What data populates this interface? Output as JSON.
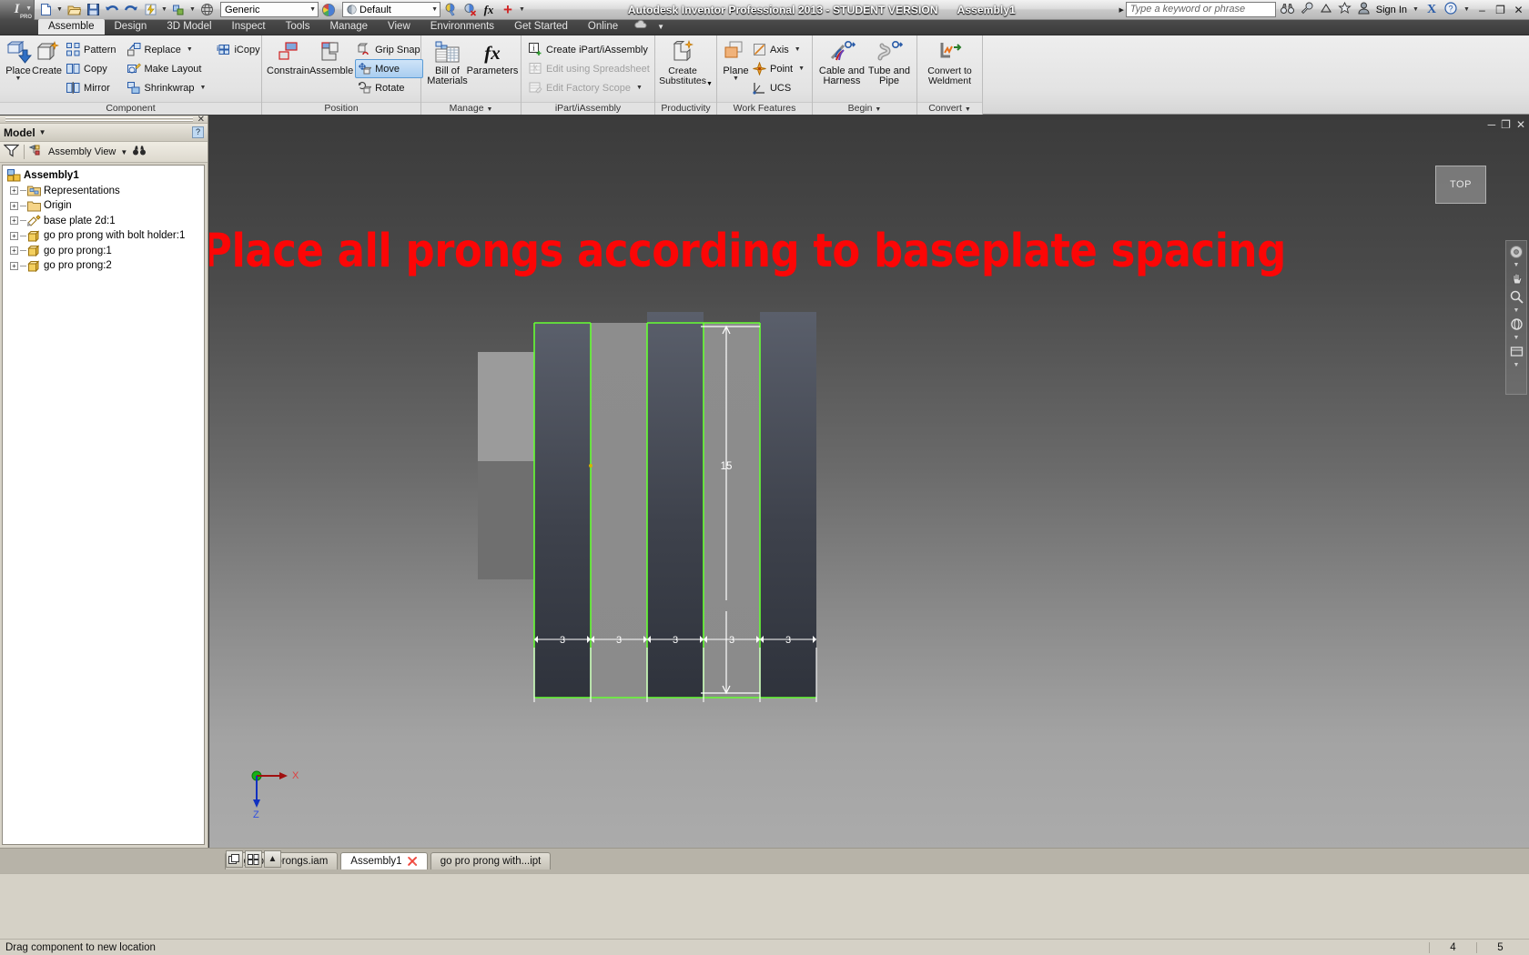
{
  "titlebar": {
    "app_title": "Autodesk Inventor Professional 2013 - STUDENT VERSION",
    "document_name": "Assembly1",
    "material_combo": "Generic",
    "appearance_combo": "Default",
    "search_placeholder": "Type a keyword or phrase",
    "sign_in": "Sign In",
    "minimize": "–",
    "restore": "❐",
    "close": "✕"
  },
  "ribbon_tabs": [
    {
      "label": "Assemble",
      "active": true
    },
    {
      "label": "Design",
      "active": false
    },
    {
      "label": "3D Model",
      "active": false
    },
    {
      "label": "Inspect",
      "active": false
    },
    {
      "label": "Tools",
      "active": false
    },
    {
      "label": "Manage",
      "active": false
    },
    {
      "label": "View",
      "active": false
    },
    {
      "label": "Environments",
      "active": false
    },
    {
      "label": "Get Started",
      "active": false
    },
    {
      "label": "Online",
      "active": false
    }
  ],
  "ribbon_panels": {
    "component": {
      "label": "Component",
      "place": "Place",
      "create": "Create",
      "pattern": "Pattern",
      "copy": "Copy",
      "mirror": "Mirror",
      "replace": "Replace",
      "make_layout": "Make Layout",
      "shrinkwrap": "Shrinkwrap",
      "icopy": "iCopy"
    },
    "position": {
      "label": "Position",
      "constrain": "Constrain",
      "assemble": "Assemble",
      "grip_snap": "Grip Snap",
      "move": "Move",
      "rotate": "Rotate"
    },
    "manage": {
      "label": "Manage",
      "bill_of_materials": "Bill of\nMaterials",
      "bom_line1": "Bill of",
      "bom_line2": "Materials",
      "parameters": "Parameters"
    },
    "ipart": {
      "label": "iPart/iAssembly",
      "create_ipart": "Create iPart/iAssembly",
      "edit_spreadsheet": "Edit using Spreadsheet",
      "edit_factory_scope": "Edit Factory Scope"
    },
    "productivity": {
      "label": "Productivity",
      "create_line1": "Create",
      "create_line2": "Substitutes"
    },
    "work_features": {
      "label": "Work Features",
      "plane": "Plane",
      "axis": "Axis",
      "point": "Point",
      "ucs": "UCS"
    },
    "begin": {
      "label": "Begin",
      "cable_line1": "Cable and",
      "cable_line2": "Harness",
      "tube_line1": "Tube and",
      "tube_line2": "Pipe"
    },
    "convert": {
      "label": "Convert",
      "convert_line1": "Convert to",
      "convert_line2": "Weldment"
    }
  },
  "browser": {
    "panel_title": "Model",
    "view_selector": "Assembly View",
    "help_badge": "?",
    "tree": [
      {
        "label": "Assembly1",
        "depth": 0,
        "expandable": false,
        "icon": "assembly-icon"
      },
      {
        "label": "Representations",
        "depth": 1,
        "expandable": true,
        "icon": "representations-folder-icon"
      },
      {
        "label": "Origin",
        "depth": 1,
        "expandable": true,
        "icon": "folder-icon"
      },
      {
        "label": "base plate 2d:1",
        "depth": 1,
        "expandable": true,
        "icon": "sketch-part-icon"
      },
      {
        "label": "go pro prong with bolt holder:1",
        "depth": 1,
        "expandable": true,
        "icon": "part-icon"
      },
      {
        "label": "go pro prong:1",
        "depth": 1,
        "expandable": true,
        "icon": "part-icon"
      },
      {
        "label": "go pro prong:2",
        "depth": 1,
        "expandable": true,
        "icon": "part-icon"
      }
    ]
  },
  "viewport": {
    "annotation": "Place all prongs according to baseplate spacing",
    "annotation_color": "#fc0606",
    "viewcube_label": "TOP",
    "vertical_dimension": "15",
    "horizontal_dimensions": [
      "3",
      "3",
      "3",
      "3",
      "3"
    ],
    "axis_x": "X",
    "axis_z": "Z",
    "highlight_color": "#66ff33"
  },
  "document_tabs": [
    {
      "label": "3 go pro prongs.iam",
      "active": false,
      "closable": false
    },
    {
      "label": "Assembly1",
      "active": true,
      "closable": true
    },
    {
      "label": "go pro prong with...ipt",
      "active": false,
      "closable": false
    }
  ],
  "statusbar": {
    "message": "Drag component to new location",
    "cell1": "4",
    "cell2": "5"
  }
}
